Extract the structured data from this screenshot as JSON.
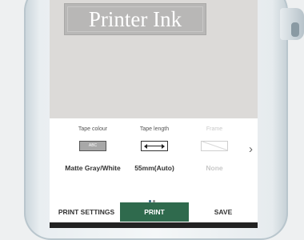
{
  "preview": {
    "label_text": "Printer Ink"
  },
  "settings": {
    "tape_colour": {
      "title": "Tape colour",
      "swatch_text": "ABC",
      "value": "Matte Gray/White"
    },
    "tape_length": {
      "title": "Tape length",
      "value": "55mm(Auto)"
    },
    "frame": {
      "title": "Frame",
      "value": "None"
    },
    "next_chevron": "›"
  },
  "pager": {
    "pages": 2,
    "current": 1
  },
  "bottom_bar": {
    "print_settings": "PRINT SETTINGS",
    "print": "PRINT",
    "save": "SAVE"
  },
  "colors": {
    "print_button": "#2f6a4d",
    "tape_swatch": "#a8a8a8",
    "preview_bg": "#dcdad8"
  }
}
